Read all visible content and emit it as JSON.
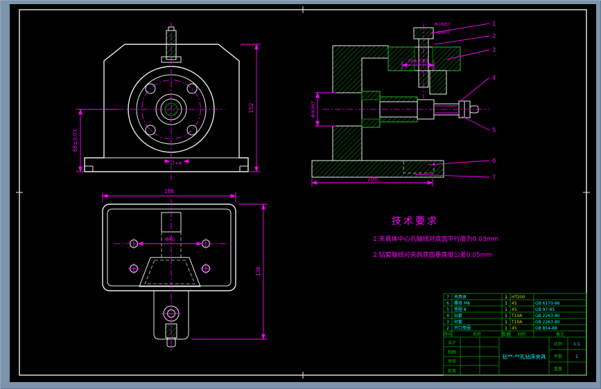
{
  "views": {
    "front": {
      "dim_left": "68±0.03",
      "dim_right": "152",
      "dim_bottom": "7×4"
    },
    "side": {
      "dim_top": "30±0.03",
      "dim_left": "Φ40H7",
      "dim_bottom": "108",
      "label_a": "Φ16H7",
      "label_b": "Φ8H7",
      "balloons": [
        "1",
        "2",
        "3",
        "4",
        "5",
        "6",
        "7"
      ]
    },
    "plan": {
      "dim_top": "188",
      "dim_right": "136",
      "dim_holes": "Φ80"
    }
  },
  "tech_req": {
    "title": "技术要求",
    "item1": "1.夹具体中心孔轴线对底面平行度为0.03mm",
    "item2": "2.钻套轴线对夹具底面垂直度公差0.05mm"
  },
  "title_block": {
    "parts": [
      {
        "no": "7",
        "name": "夹具体",
        "qty": "1",
        "mat": "HT200",
        "std": ""
      },
      {
        "no": "6",
        "name": "螺母 M8",
        "qty": "1",
        "mat": "45",
        "std": "GB 6170-86"
      },
      {
        "no": "5",
        "name": "垫圈 8",
        "qty": "1",
        "mat": "45",
        "std": "GB 97-85"
      },
      {
        "no": "4",
        "name": "钻套",
        "qty": "1",
        "mat": "T10A",
        "std": "GB 2263-80"
      },
      {
        "no": "3",
        "name": "衬套",
        "qty": "1",
        "mat": "T10A",
        "std": "GB 2263-80"
      },
      {
        "no": "2",
        "name": "开口垫圈",
        "qty": "1",
        "mat": "45",
        "std": "GB 854-88"
      }
    ],
    "headers": {
      "no": "序号",
      "name": "名称",
      "qty": "数量",
      "mat": "材料",
      "std": "备注"
    },
    "sign_rows": [
      "设计",
      "制图",
      "审核",
      "批准"
    ],
    "title": "钻**-**孔钻床夹具",
    "scale_label": "比例",
    "scale_value": "1:1",
    "qty_label": "件数",
    "qty_value": "1",
    "weight_label": "重量",
    "weight_value": ""
  },
  "colors": {
    "background": "#000000",
    "window_border": "#7c94ac",
    "geometry": "#ececec",
    "dimension": "#ff00ff",
    "hatch": "#00a800",
    "table_line": "#00a000",
    "table_text": "#00ffff"
  }
}
